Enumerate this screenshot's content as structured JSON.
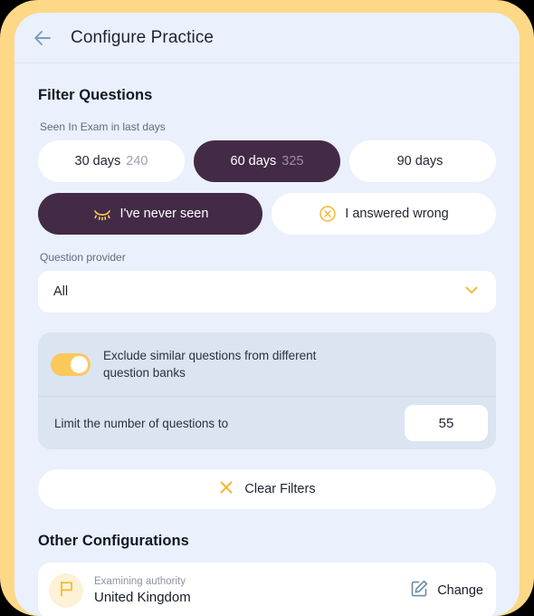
{
  "header": {
    "back_icon": "arrow-left-icon",
    "title": "Configure Practice"
  },
  "filter_section": {
    "title": "Filter Questions",
    "seen_label": "Seen In Exam in last days",
    "day_chips": [
      {
        "label": "30 days",
        "count": "240",
        "selected": false
      },
      {
        "label": "60 days",
        "count": "325",
        "selected": true
      },
      {
        "label": "90 days",
        "count": "",
        "selected": false
      }
    ],
    "status_pills": [
      {
        "label": "I've never seen",
        "icon": "eye-closed-icon",
        "selected": true
      },
      {
        "label": "I answered wrong",
        "icon": "x-circle-icon",
        "selected": false
      }
    ],
    "provider_label": "Question provider",
    "provider_value": "All",
    "provider_icon": "chevron-down-icon",
    "exclude_similar_label": "Exclude similar questions from different question banks",
    "exclude_similar_on": true,
    "limit_label": "Limit the number of questions to",
    "limit_value": "55",
    "clear_filters_label": "Clear Filters",
    "clear_filters_icon": "x-icon"
  },
  "other_section": {
    "title": "Other Configurations",
    "authority_icon": "flag-icon",
    "authority_label": "Examining authority",
    "authority_value": "United Kingdom",
    "change_label": "Change",
    "change_icon": "edit-square-icon"
  },
  "colors": {
    "frame": "#fcd887",
    "screen_bg": "#eaf0fc",
    "accent_purple": "#432a46",
    "accent_yellow": "#fbc85c",
    "card_bg": "#dbe4f1",
    "white": "#ffffff"
  }
}
